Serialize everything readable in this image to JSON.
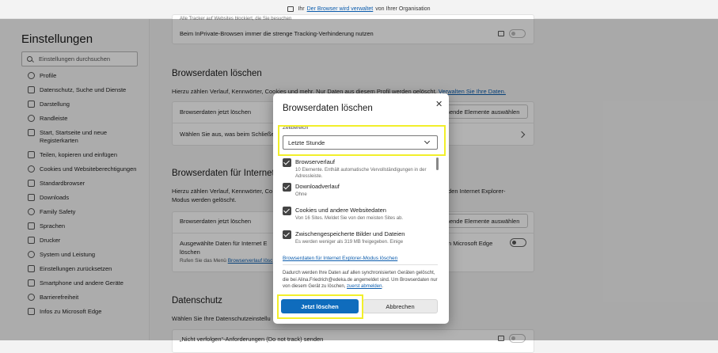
{
  "topbar": {
    "prefix": "Ihr",
    "link": "Der Browser wird verwaltet",
    "suffix": "von Ihrer Organisation"
  },
  "sidebar": {
    "title": "Einstellungen",
    "search_placeholder": "Einstellungen durchsuchen",
    "items": [
      {
        "label": "Profile",
        "icon": "profile-icon"
      },
      {
        "label": "Datenschutz, Suche und Dienste",
        "icon": "lock-icon"
      },
      {
        "label": "Darstellung",
        "icon": "appearance-icon"
      },
      {
        "label": "Randleiste",
        "icon": "sidebar-icon"
      },
      {
        "label": "Start, Startseite und neue Registerkarten",
        "icon": "start-icon"
      },
      {
        "label": "Teilen, kopieren und einfügen",
        "icon": "share-icon"
      },
      {
        "label": "Cookies und Websiteberechtigungen",
        "icon": "cookie-icon"
      },
      {
        "label": "Standardbrowser",
        "icon": "browser-icon"
      },
      {
        "label": "Downloads",
        "icon": "download-icon"
      },
      {
        "label": "Family Safety",
        "icon": "family-icon"
      },
      {
        "label": "Sprachen",
        "icon": "language-icon"
      },
      {
        "label": "Drucker",
        "icon": "printer-icon"
      },
      {
        "label": "System und Leistung",
        "icon": "system-icon"
      },
      {
        "label": "Einstellungen zurücksetzen",
        "icon": "reset-icon"
      },
      {
        "label": "Smartphone und andere Geräte",
        "icon": "phone-icon"
      },
      {
        "label": "Barrierefreiheit",
        "icon": "accessibility-icon"
      },
      {
        "label": "Infos zu Microsoft Edge",
        "icon": "edge-icon"
      }
    ]
  },
  "main": {
    "cut_top_text": "Alle Tracker auf Websites blockiert, die Sie besuchen",
    "inprivate_label": "Beim InPrivate-Browsen immer die strenge Tracking-Verhinderung nutzen",
    "section1": {
      "title": "Browserdaten löschen",
      "desc": "Hierzu zählen Verlauf, Kennwörter, Cookies und mehr. Nur Daten aus diesem Profil werden gelöscht.",
      "desc_link": "Verwalten Sie Ihre Daten.",
      "row1_label": "Browserdaten jetzt löschen",
      "row1_button": "Zu löschende Elemente auswählen",
      "row2_label": "Wählen Sie aus, was beim Schließen"
    },
    "section2": {
      "title": "Browserdaten für Internet",
      "desc": "Hierzu zählen Verlauf, Kennwörter, Co",
      "desc_right": "den Internet Explorer-",
      "desc2": "Modus werden gelöscht.",
      "row1_label": "Browserdaten jetzt löschen",
      "row1_button": "Zu löschende Elemente auswählen",
      "row2_label": "Ausgewählte Daten für Internet E",
      "row2_label_b": "löschen",
      "row2_right": "n Microsoft Edge",
      "row2_desc": "Rufen Sie das Menü",
      "row2_desc_link": "Browserverlauf lösc"
    },
    "section3": {
      "title": "Datenschutz",
      "desc": "Wählen Sie Ihre Datenschutzeinstellu",
      "row1_label": "„Nicht verfolgen“-Anforderungen (Do not track) senden"
    }
  },
  "dialog": {
    "title": "Browserdaten löschen",
    "close": "✕",
    "range_label": "Zeitbereich",
    "range_value": "Letzte Stunde",
    "options": [
      {
        "title": "Browserverlauf",
        "desc": "10 Elemente. Enthält automatische Vervollständigungen in der Adressleiste.",
        "checked": true
      },
      {
        "title": "Downloadverlauf",
        "desc": "Ohne",
        "checked": true
      },
      {
        "title": "Cookies und andere Websitedaten",
        "desc": "Von 16 Sites. Meldet Sie von den meisten Sites ab.",
        "checked": true
      },
      {
        "title": "Zwischengespeicherte Bilder und Dateien",
        "desc": "Es werden weniger als 319 MB freigegeben. Einige",
        "checked": true
      }
    ],
    "ie_link": "Browserdaten für Internet Explorer-Modus löschen",
    "notice": "Dadurch werden Ihre Daten auf allen synchronisierten Geräten gelöscht, die bei Alina.Friedrich@edeka.de angemeldet sind. Um Browserdaten nur von diesem Gerät zu löschen,",
    "notice_link": "zuerst abmelden",
    "notice_end": ".",
    "primary_button": "Jetzt löschen",
    "secondary_button": "Abbrechen"
  },
  "colors": {
    "primary": "#0f6cbd",
    "highlight": "#f2ef2a",
    "link": "#0b5cad"
  }
}
